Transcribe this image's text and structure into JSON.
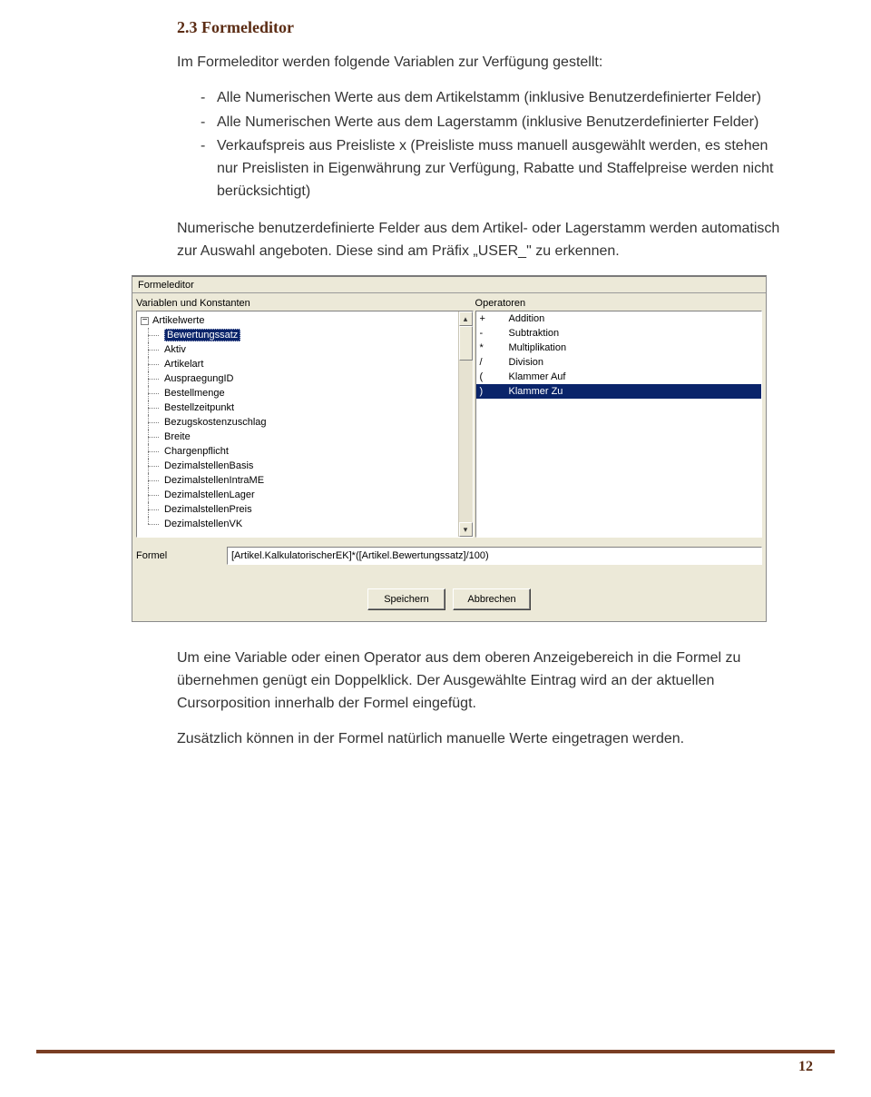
{
  "heading": "2.3 Formeleditor",
  "intro": "Im Formeleditor werden folgende Variablen zur Verfügung gestellt:",
  "bullets": {
    "b1": "Alle Numerischen Werte aus dem Artikelstamm (inklusive Benutzerdefinierter Felder)",
    "b2": "Alle Numerischen Werte aus dem Lagerstamm (inklusive Benutzerdefinierter Felder)",
    "b3": "Verkaufspreis aus Preisliste x (Preisliste muss manuell ausgewählt werden, es stehen nur Preislisten in Eigenwährung zur Verfügung, Rabatte und Staffelpreise werden nicht berücksichtigt)"
  },
  "para2": "Numerische benutzerdefinierte Felder aus dem Artikel- oder Lagerstamm werden automatisch zur Auswahl angeboten. Diese sind am Präfix „USER_\" zu erkennen.",
  "para3": "Um eine Variable oder einen Operator aus dem oberen Anzeigebereich in die Formel zu übernehmen genügt ein Doppelklick. Der Ausgewählte Eintrag wird an der aktuellen Cursorposition innerhalb der Formel eingefügt.",
  "para4": "Zusätzlich können in der Formel natürlich manuelle Werte eingetragen werden.",
  "page_number": "12",
  "screenshot": {
    "title": "Formeleditor",
    "left_label": "Variablen und Konstanten",
    "right_label": "Operatoren",
    "tree_root": "Artikelwerte",
    "tree_selected": "Bewertungssatz",
    "tree_items": {
      "i2": "Aktiv",
      "i3": "Artikelart",
      "i4": "AuspraegungID",
      "i5": "Bestellmenge",
      "i6": "Bestellzeitpunkt",
      "i7": "Bezugskostenzuschlag",
      "i8": "Breite",
      "i9": "Chargenpflicht",
      "i10": "DezimalstellenBasis",
      "i11": "DezimalstellenIntraME",
      "i12": "DezimalstellenLager",
      "i13": "DezimalstellenPreis",
      "i14": "DezimalstellenVK"
    },
    "operators": {
      "r1s": "+",
      "r1t": "Addition",
      "r2s": "-",
      "r2t": "Subtraktion",
      "r3s": "*",
      "r3t": "Multiplikation",
      "r4s": "/",
      "r4t": "Division",
      "r5s": "(",
      "r5t": "Klammer Auf",
      "r6s": ")",
      "r6t": "Klammer Zu"
    },
    "formula_label": "Formel",
    "formula_value": "[Artikel.KalkulatorischerEK]*([Artikel.Bewertungssatz]/100)",
    "btn_save": "Speichern",
    "btn_cancel": "Abbrechen"
  }
}
